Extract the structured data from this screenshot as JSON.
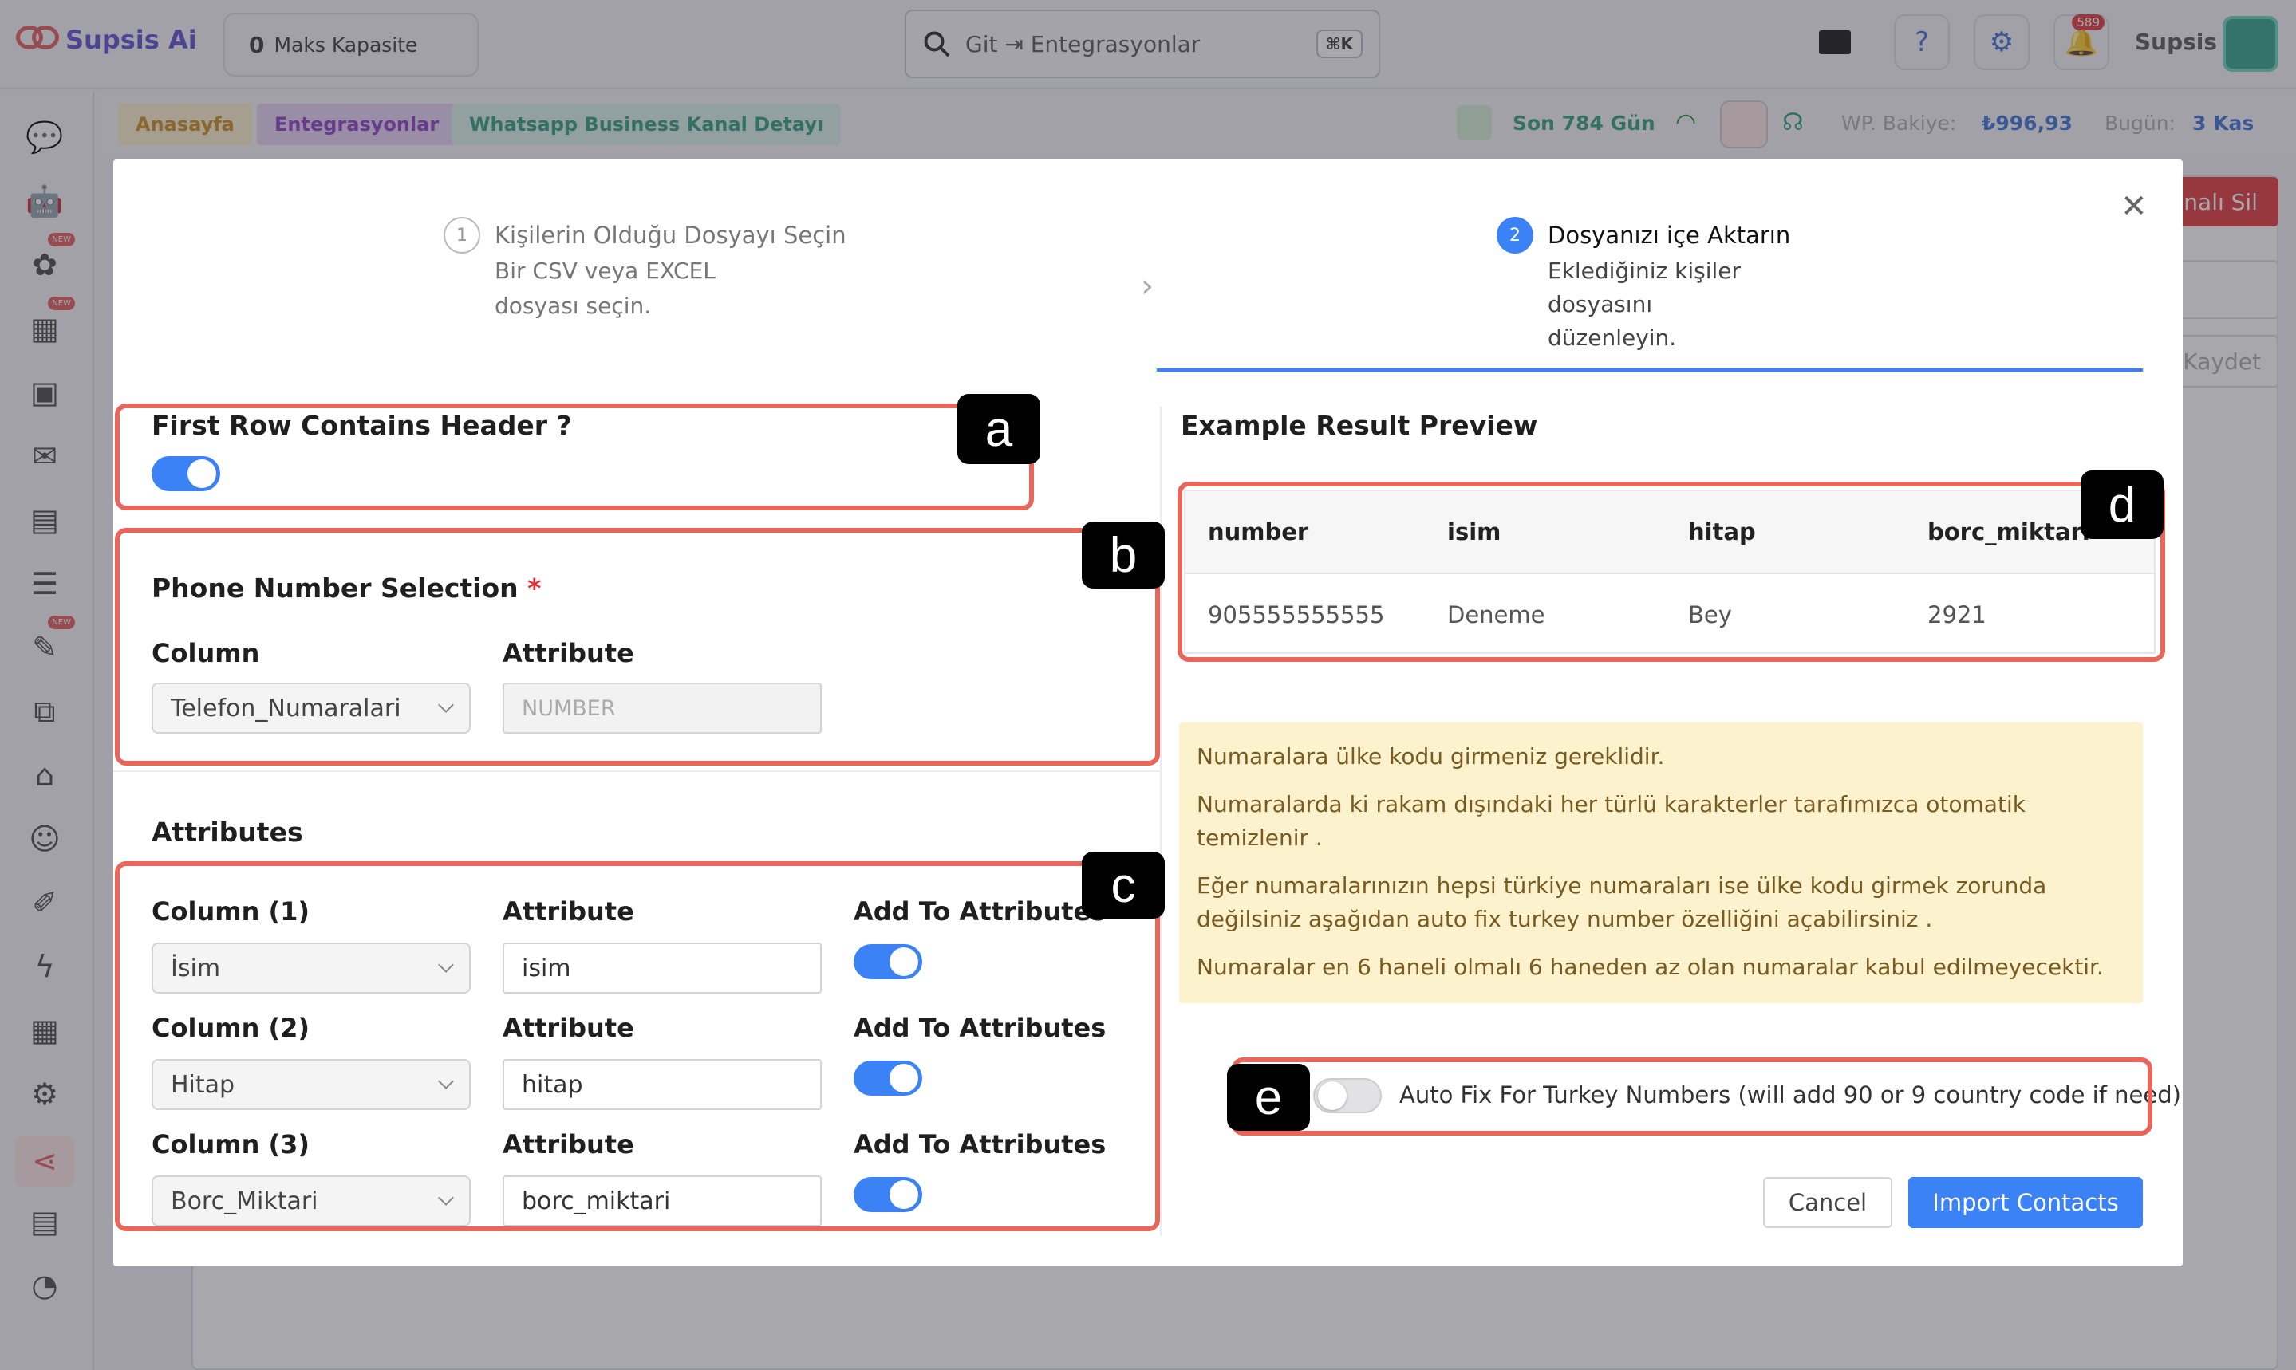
{
  "app": {
    "name": "Supsis Ai",
    "user": "Supsis"
  },
  "header": {
    "capacity_value": "0",
    "capacity_label": "Maks Kapasite",
    "search_text": "Git ⇥ Entegrasyonlar",
    "search_shortcut": "⌘K",
    "notification_count": "589"
  },
  "breadcrumb": [
    "Anasayfa",
    "Entegrasyonlar",
    "Whatsapp Business Kanal Detayı"
  ],
  "status": {
    "days": "Son 784 Gün",
    "balance_label": "WP. Bakiye:",
    "balance_value": "₺996,93",
    "today_label": "Bugün:",
    "today_value": "3 Kas"
  },
  "background": {
    "delete_button": "nalı Sil",
    "save_button": "Kaydet"
  },
  "modal": {
    "steps": [
      {
        "number": "1",
        "title": "Kişilerin Olduğu Dosyayı Seçin",
        "desc": [
          "Bir CSV veya EXCEL",
          "dosyası seçin."
        ]
      },
      {
        "number": "2",
        "title": "Dosyanızı içe Aktarın",
        "desc": [
          "Eklediğiniz kişiler",
          "dosyasını",
          "düzenleyin."
        ]
      }
    ],
    "header_row_label": "First Row Contains Header ?",
    "header_row_enabled": true,
    "phone_section_title": "Phone Number Selection",
    "required_mark": "*",
    "column_label": "Column",
    "attribute_label": "Attribute",
    "phone_column": "Telefon_Numaralari",
    "phone_attribute_placeholder": "NUMBER",
    "attributes_title": "Attributes",
    "attribute_rows": [
      {
        "column_label": "Column (1)",
        "column_value": "İsim",
        "attribute_label": "Attribute",
        "attribute_value": "isim",
        "add_label": "Add To Attributes",
        "enabled": true
      },
      {
        "column_label": "Column (2)",
        "column_value": "Hitap",
        "attribute_label": "Attribute",
        "attribute_value": "hitap",
        "add_label": "Add To Attributes",
        "enabled": true
      },
      {
        "column_label": "Column (3)",
        "column_value": "Borc_Miktari",
        "attribute_label": "Attribute",
        "attribute_value": "borc_miktari",
        "add_label": "Add To Attributes",
        "enabled": true
      }
    ],
    "preview_title": "Example Result Preview",
    "preview_table": {
      "headers": [
        "number",
        "isim",
        "hitap",
        "borc_miktari"
      ],
      "rows": [
        [
          "905555555555",
          "Deneme",
          "Bey",
          "2921"
        ]
      ]
    },
    "warnings": [
      "Numaralara ülke kodu girmeniz gereklidir.",
      "Numaralarda ki rakam dışındaki her türlü karakterler tarafımızca otomatik temizlenir .",
      "Eğer numaralarınızın hepsi türkiye numaraları ise ülke kodu girmek zorunda değilsiniz aşağıdan auto fix turkey number özelliğini açabilirsiniz .",
      "Numaralar en 6 haneli olmalı 6 haneden az olan numaralar kabul edilmeyecektir."
    ],
    "autofix_label": "Auto Fix For Turkey Numbers (will add 90 or 9 country code if need)",
    "autofix_enabled": false,
    "cancel_button": "Cancel",
    "import_button": "Import Contacts"
  },
  "annotations": [
    "a",
    "b",
    "c",
    "d",
    "e"
  ],
  "colors": {
    "accent": "#3b82f6",
    "annotation": "#e8665a",
    "warning_bg": "#fcf2cd"
  }
}
